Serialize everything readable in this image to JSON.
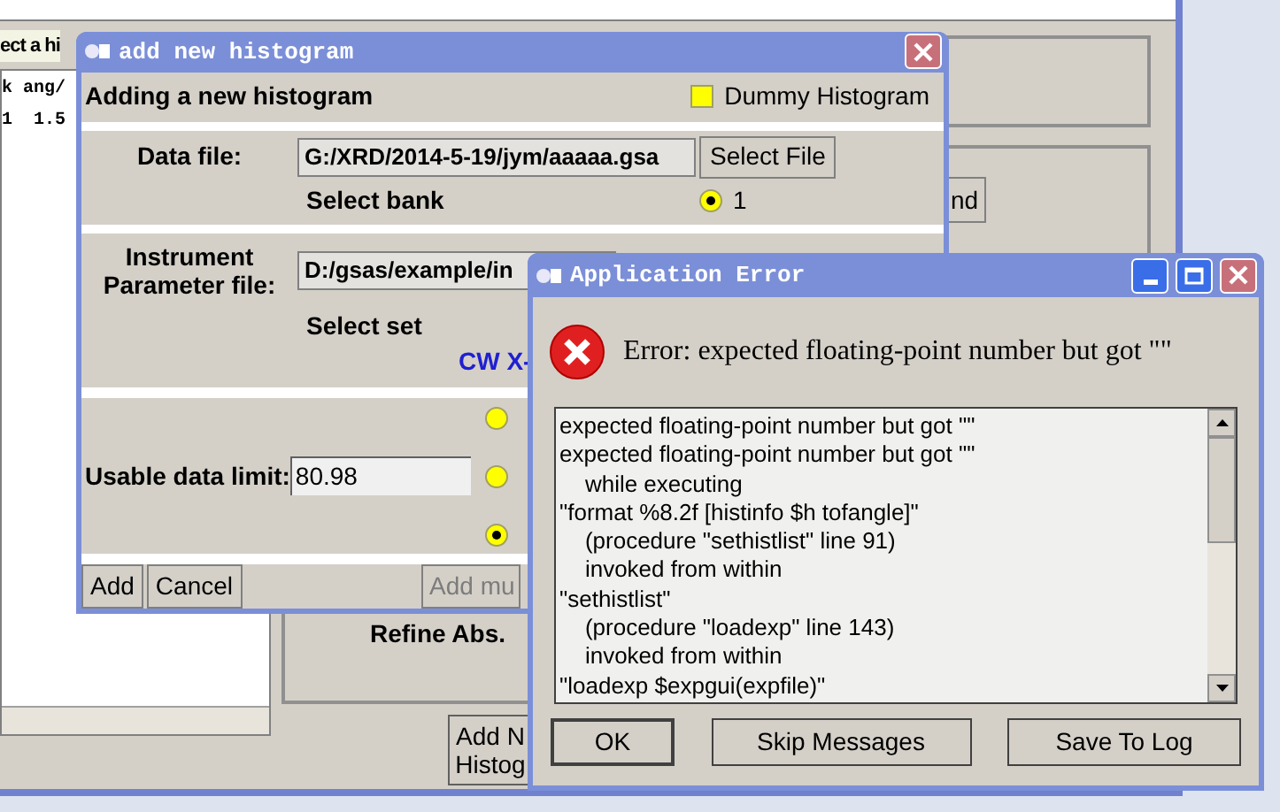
{
  "background_window": {
    "list_header": "ect a hi",
    "list_rows": [
      "k ang/",
      "1  1.5"
    ],
    "side_button": "nd",
    "section_label": "Refine Abs.",
    "add_button": [
      "Add N",
      "Histog"
    ]
  },
  "add_dialog": {
    "title": "add new histogram",
    "heading": "Adding a new histogram",
    "dummy": {
      "label": "Dummy Histogram",
      "checked": false
    },
    "data_file": {
      "label": "Data file:",
      "value": "G:/XRD/2014-5-19/jym/aaaaa.gsa",
      "button": "Select File"
    },
    "bank": {
      "label": "Select bank",
      "options": [
        {
          "label": "1",
          "selected": true
        }
      ]
    },
    "instrument": {
      "label": [
        "Instrument",
        "Parameter file:"
      ],
      "value": "D:/gsas/example/in"
    },
    "set": {
      "label": "Select set",
      "option": "CW X-"
    },
    "limit": {
      "label": "Usable data limit:",
      "value": "80.98",
      "options": [
        {
          "selected": false
        },
        {
          "selected": false
        },
        {
          "selected": true
        }
      ]
    },
    "buttons": [
      {
        "label": "Add",
        "disabled": false
      },
      {
        "label": "Cancel",
        "disabled": false
      },
      {
        "label": "Add mu",
        "disabled": true
      }
    ]
  },
  "error_dialog": {
    "title": "Application Error",
    "message": "Error: expected floating-point number but got \"\"",
    "log": [
      "expected floating-point number but got \"\"",
      "expected floating-point number but got \"\"",
      "    while executing",
      "\"format %8.2f [histinfo $h tofangle]\"",
      "    (procedure \"sethistlist\" line 91)",
      "    invoked from within",
      "\"sethistlist\"",
      "    (procedure \"loadexp\" line 143)",
      "    invoked from within",
      "\"loadexp $expgui(expfile)\""
    ],
    "buttons": [
      "OK",
      "Skip Messages",
      "Save To Log"
    ]
  }
}
